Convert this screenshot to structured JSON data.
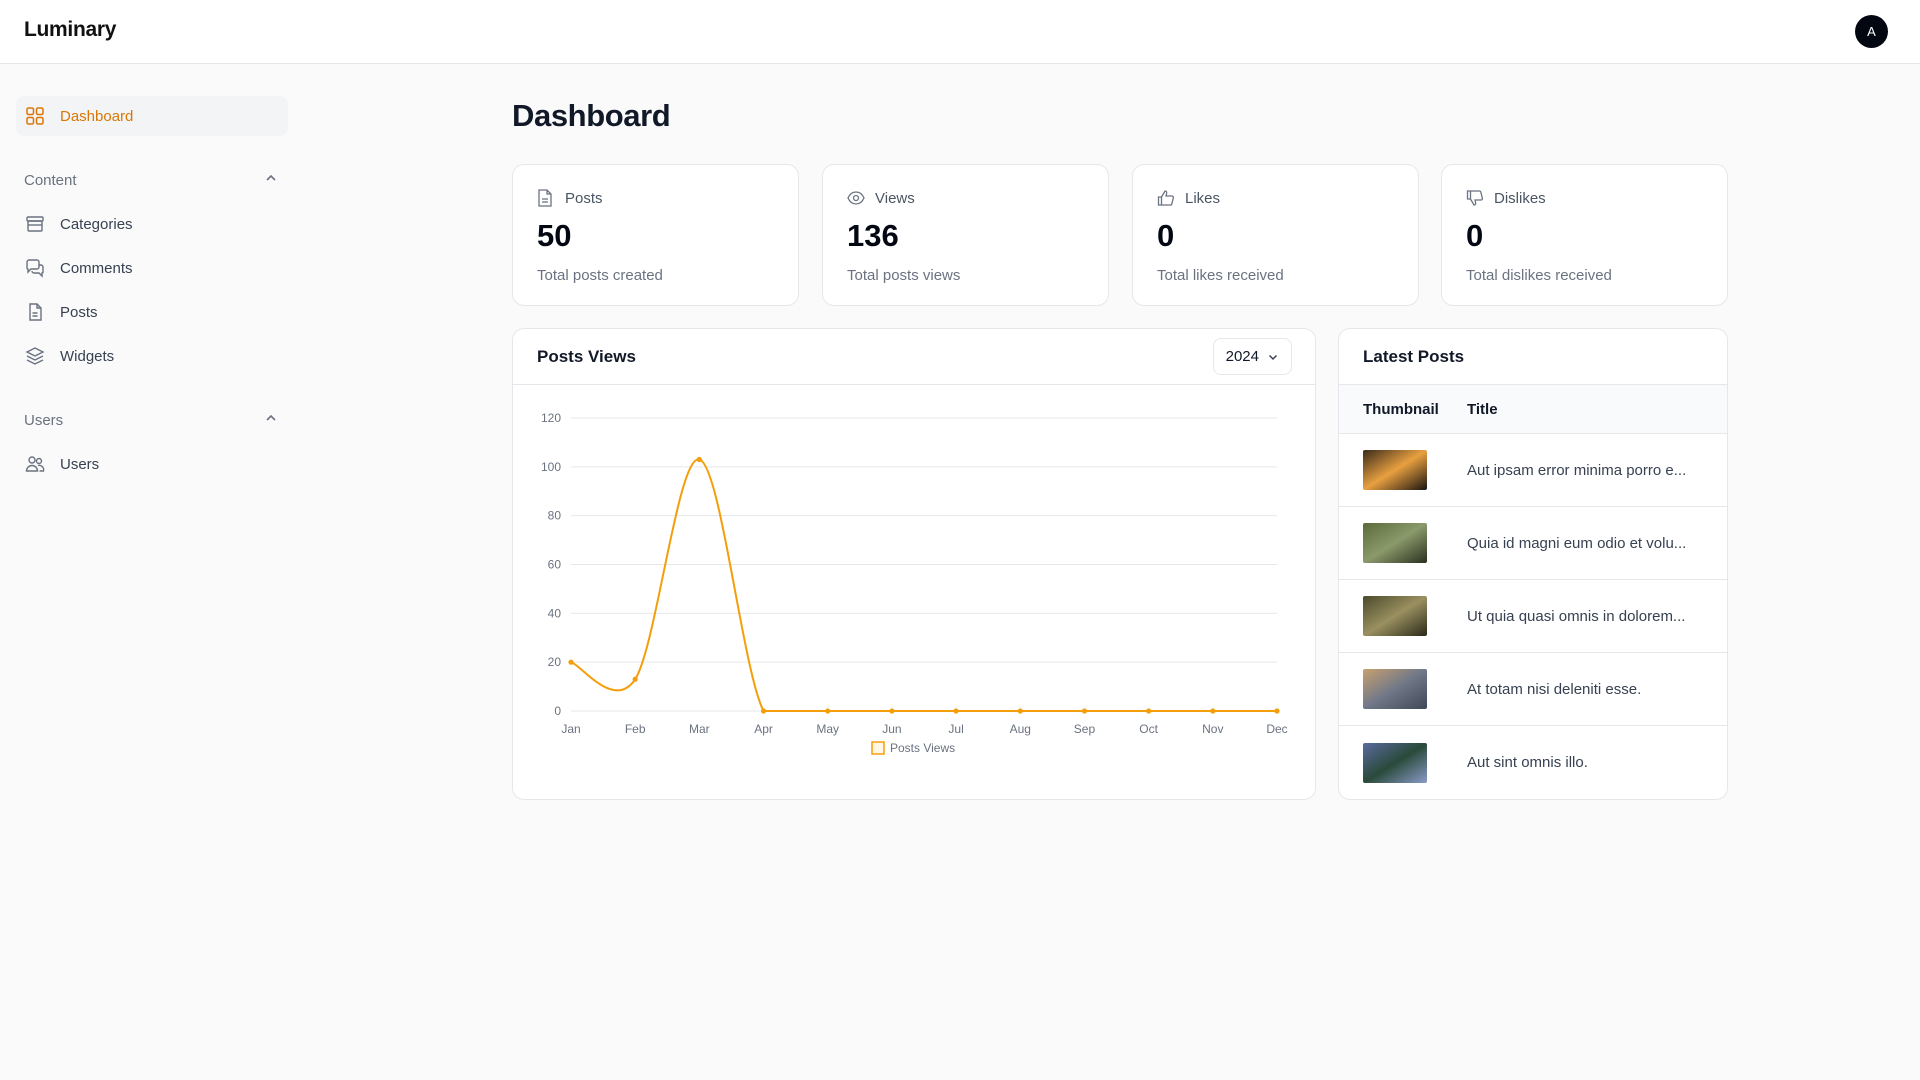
{
  "app": {
    "brand": "Luminary",
    "avatar_initial": "A",
    "accent": "#d97706"
  },
  "sidebar": {
    "dashboard": {
      "label": "Dashboard",
      "icon": "dashboard-grid-icon"
    },
    "groups": [
      {
        "label": "Content",
        "items": [
          {
            "label": "Categories",
            "icon": "archive-box-icon"
          },
          {
            "label": "Comments",
            "icon": "chat-bubbles-icon"
          },
          {
            "label": "Posts",
            "icon": "document-icon"
          },
          {
            "label": "Widgets",
            "icon": "stack-icon"
          }
        ]
      },
      {
        "label": "Users",
        "items": [
          {
            "label": "Users",
            "icon": "users-icon"
          }
        ]
      }
    ]
  },
  "page": {
    "title": "Dashboard"
  },
  "stats": [
    {
      "label": "Posts",
      "value": "50",
      "desc": "Total posts created",
      "icon": "document-icon"
    },
    {
      "label": "Views",
      "value": "136",
      "desc": "Total posts views",
      "icon": "eye-icon"
    },
    {
      "label": "Likes",
      "value": "0",
      "desc": "Total likes received",
      "icon": "thumb-up-icon"
    },
    {
      "label": "Dislikes",
      "value": "0",
      "desc": "Total dislikes received",
      "icon": "thumb-down-icon"
    }
  ],
  "chart_card": {
    "title": "Posts Views",
    "year": "2024"
  },
  "chart_data": {
    "type": "line",
    "categories": [
      "Jan",
      "Feb",
      "Mar",
      "Apr",
      "May",
      "Jun",
      "Jul",
      "Aug",
      "Sep",
      "Oct",
      "Nov",
      "Dec"
    ],
    "series": [
      {
        "name": "Posts Views",
        "values": [
          20,
          13,
          103,
          0,
          0,
          0,
          0,
          0,
          0,
          0,
          0,
          0
        ],
        "color": "#f59e0b"
      }
    ],
    "yticks": [
      0,
      20,
      40,
      60,
      80,
      100,
      120
    ],
    "ylim": [
      0,
      120
    ],
    "grid": true,
    "legend": "bottom"
  },
  "latest": {
    "title": "Latest Posts",
    "columns": [
      "Thumbnail",
      "Title"
    ],
    "rows": [
      {
        "title": "Aut ipsam error minima porro e...",
        "thumb": [
          "#3a2a1a",
          "#e8a040",
          "#1a1410"
        ]
      },
      {
        "title": "Quia id magni eum odio et volu...",
        "thumb": [
          "#5a6a3a",
          "#8a9a6a",
          "#2a3020"
        ]
      },
      {
        "title": "Ut quia quasi omnis in dolorem...",
        "thumb": [
          "#4a4a2a",
          "#9a9060",
          "#2a2a18"
        ]
      },
      {
        "title": "At totam nisi deleniti esse.",
        "thumb": [
          "#c8a070",
          "#707888",
          "#404858"
        ]
      },
      {
        "title": "Aut sint omnis illo.",
        "thumb": [
          "#5a6aa0",
          "#2a4a3a",
          "#8a9ac8"
        ]
      }
    ]
  }
}
